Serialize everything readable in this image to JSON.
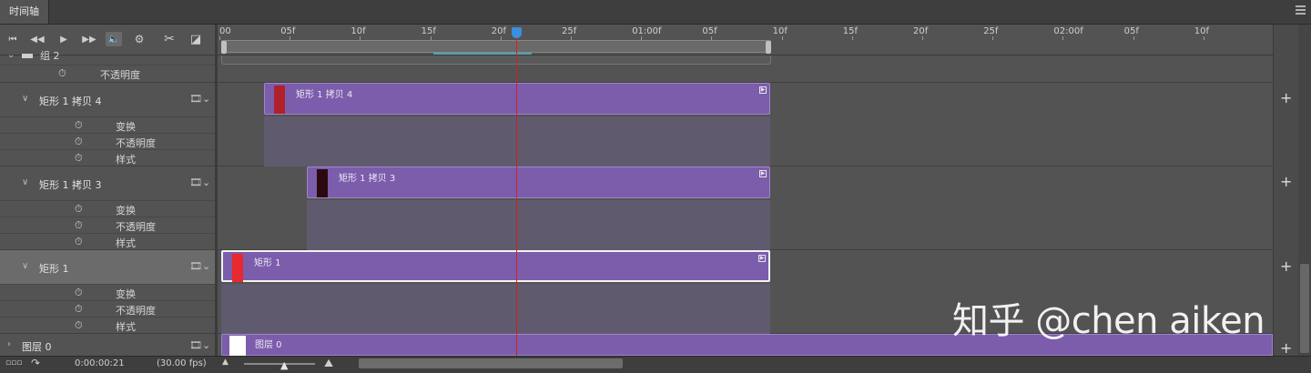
{
  "panel": {
    "tab_label": "时间轴"
  },
  "ruler": {
    "ticks": [
      "00",
      "05f",
      "10f",
      "15f",
      "20f",
      "25f",
      "01:00f",
      "05f",
      "10f",
      "15f",
      "20f",
      "25f",
      "02:00f",
      "05f",
      "10f"
    ]
  },
  "layers": [
    {
      "id": "group",
      "name": "组 2",
      "props": [
        "不透明度"
      ]
    },
    {
      "id": "copy4",
      "name": "矩形 1 拷贝 4",
      "props": [
        "变换",
        "不透明度",
        "样式"
      ],
      "clip_label": "矩形 1 拷贝 4",
      "thumb_color": "#b0212a"
    },
    {
      "id": "copy3",
      "name": "矩形 1 拷贝 3",
      "props": [
        "变换",
        "不透明度",
        "样式"
      ],
      "clip_label": "矩形 1 拷贝 3",
      "thumb_color": "#2a0a10"
    },
    {
      "id": "rect1",
      "name": "矩形 1",
      "props": [
        "变换",
        "不透明度",
        "样式"
      ],
      "clip_label": "矩形 1",
      "thumb_color": "#e8282f",
      "selected": true
    },
    {
      "id": "layer0",
      "name": "图层 0",
      "clip_label": "图层 0",
      "thumb_color": "#ffffff"
    }
  ],
  "footer": {
    "time": "0:00:00:21",
    "fps": "(30.00 fps)"
  },
  "watermark": "知乎 @chen aiken",
  "colors": {
    "clip": "#7b5dab",
    "playhead": "#d32020",
    "playhead_handle": "#3a8fe0",
    "cache_bar": "#4fa3b6"
  }
}
